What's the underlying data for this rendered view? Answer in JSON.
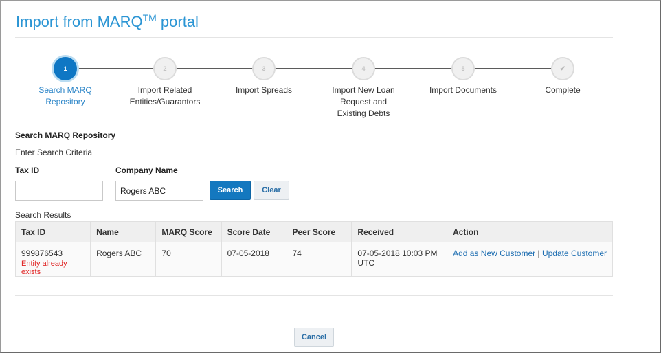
{
  "header": {
    "title": "Import from MARQ",
    "title_sup": "TM",
    "title_suffix": " portal"
  },
  "stepper": {
    "steps": [
      {
        "number": "1",
        "label": "Search MARQ Repository",
        "state": "active"
      },
      {
        "number": "2",
        "label": "Import Related Entities/Guarantors",
        "state": "pending"
      },
      {
        "number": "3",
        "label": "Import Spreads",
        "state": "pending"
      },
      {
        "number": "4",
        "label": "Import New Loan Request and Existing Debts",
        "state": "pending"
      },
      {
        "number": "5",
        "label": "Import Documents",
        "state": "pending"
      },
      {
        "number": "✔",
        "label": "Complete",
        "state": "pending"
      }
    ]
  },
  "search": {
    "section_title": "Search MARQ Repository",
    "criteria_label": "Enter Search Criteria",
    "tax_id_label": "Tax ID",
    "tax_id_value": "",
    "company_name_label": "Company Name",
    "company_name_value": "Rogers ABC",
    "search_button": "Search",
    "clear_button": "Clear"
  },
  "results": {
    "label": "Search Results",
    "columns": [
      "Tax ID",
      "Name",
      "MARQ Score",
      "Score Date",
      "Peer Score",
      "Received",
      "Action"
    ],
    "rows": [
      {
        "tax_id": "999876543",
        "error": "Entity already exists",
        "name": "Rogers ABC",
        "marq_score": "70",
        "score_date": "07-05-2018",
        "peer_score": "74",
        "received": "07-05-2018 10:03 PM UTC",
        "action_add": "Add as New Customer",
        "action_sep": "|",
        "action_update": "Update Customer"
      }
    ]
  },
  "footer": {
    "cancel_button": "Cancel"
  },
  "colors": {
    "accent": "#2b95d4",
    "primary_button": "#1478bf",
    "error": "#e02020",
    "link": "#1f6fb2"
  }
}
